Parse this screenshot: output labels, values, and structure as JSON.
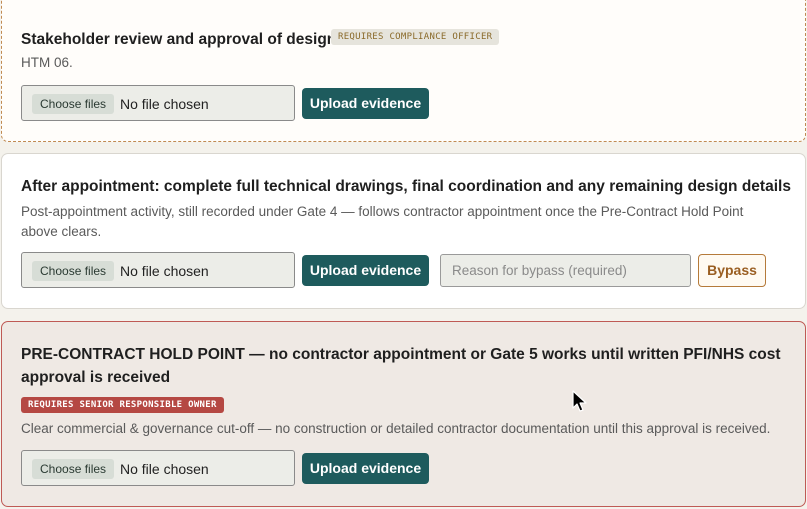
{
  "items": [
    {
      "title": "Stakeholder review and approval of design",
      "badge": "REQUIRES COMPLIANCE OFFICER",
      "description": "HTM 06.",
      "choose_label": "Choose files",
      "no_file_label": "No file chosen",
      "upload_label": "Upload evidence"
    },
    {
      "title": "After appointment: complete full technical drawings, final coordination and any remaining design details",
      "description_line1": "Post-appointment activity, still recorded under Gate 4 — follows contractor appointment once the Pre-Contract Hold Point",
      "description_line2": "above clears.",
      "choose_label": "Choose files",
      "no_file_label": "No file chosen",
      "upload_label": "Upload evidence",
      "reason_placeholder": "Reason for bypass (required)",
      "bypass_label": "Bypass"
    },
    {
      "title_line1": "PRE-CONTRACT HOLD POINT — no contractor appointment or Gate 5 works until written PFI/NHS cost",
      "title_line2": "approval is received",
      "badge": "REQUIRES SENIOR RESPONSIBLE OWNER",
      "description": "Clear commercial & governance cut-off — no construction or detailed contractor documentation until this approval is received.",
      "choose_label": "Choose files",
      "no_file_label": "No file chosen",
      "upload_label": "Upload evidence"
    }
  ],
  "colors": {
    "primary_button": "#1e5b5d",
    "amber_border": "#c08a52",
    "danger": "#b54843"
  },
  "icons": {
    "cursor": "mouse-pointer-icon"
  }
}
